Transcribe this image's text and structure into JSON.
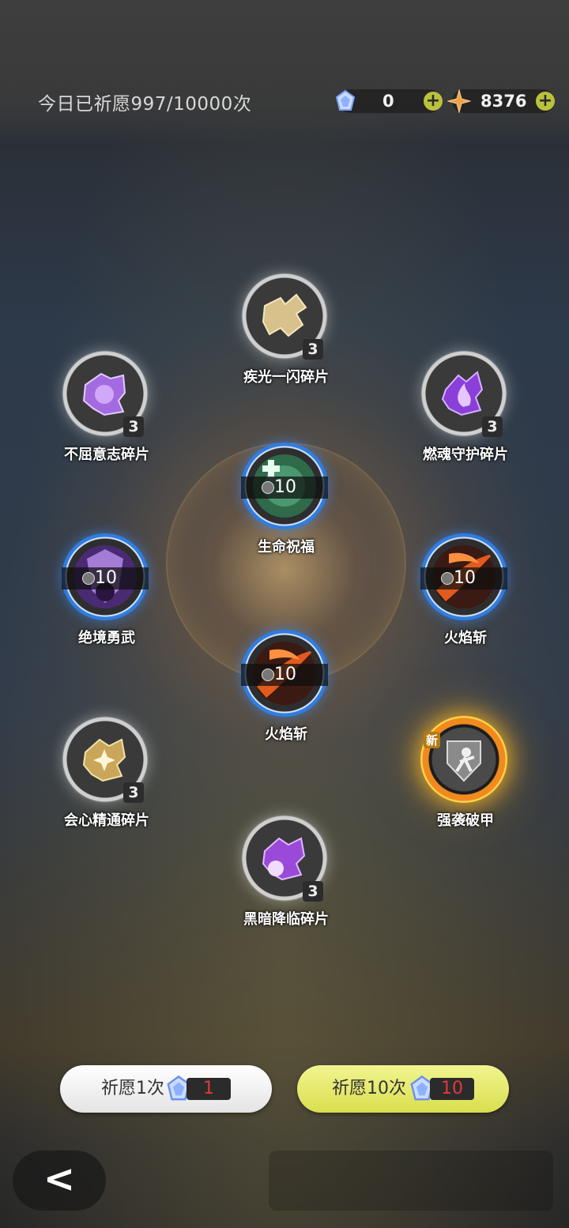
{
  "header": {
    "wish_count": "今日已祈愿997/10000次",
    "resource_gem": "0",
    "resource_star": "8376",
    "plus": "+"
  },
  "items": [
    {
      "label": "疾光一闪碎片",
      "kind": "fragment",
      "count": "3",
      "icon": "golden-puzzle-icon"
    },
    {
      "label": "不屈意志碎片",
      "kind": "fragment",
      "count": "3",
      "icon": "purple-shield-puzzle-icon"
    },
    {
      "label": "燃魂守护碎片",
      "kind": "fragment",
      "count": "3",
      "icon": "purple-flame-puzzle-icon"
    },
    {
      "label": "生命祝福",
      "kind": "skill",
      "count": "10",
      "icon": "green-cross-icon"
    },
    {
      "label": "绝境勇武",
      "kind": "skill",
      "count": "10",
      "icon": "purple-warrior-icon"
    },
    {
      "label": "火焰斩",
      "kind": "skill",
      "count": "10",
      "icon": "fire-slash-icon"
    },
    {
      "label": "火焰斩",
      "kind": "skill",
      "count": "10",
      "icon": "fire-slash-icon"
    },
    {
      "label": "会心精通碎片",
      "kind": "fragment",
      "count": "3",
      "icon": "gold-crit-puzzle-icon"
    },
    {
      "label": "强袭破甲",
      "kind": "skill",
      "count": "",
      "icon": "armor-break-icon",
      "new_tag": "新"
    },
    {
      "label": "黑暗降临碎片",
      "kind": "fragment",
      "count": "3",
      "icon": "dark-puzzle-icon"
    }
  ],
  "buttons": {
    "wish1_label": "祈愿1次",
    "wish1_cost": "1",
    "wish10_label": "祈愿10次",
    "wish10_cost": "10"
  },
  "nav": {
    "back": "<"
  },
  "colors": {
    "accent_lime": "#e4ea6a",
    "cost_red": "#e03a3a",
    "skill_ring": "#2f7de0",
    "gold_ring": "#f08a1e"
  }
}
